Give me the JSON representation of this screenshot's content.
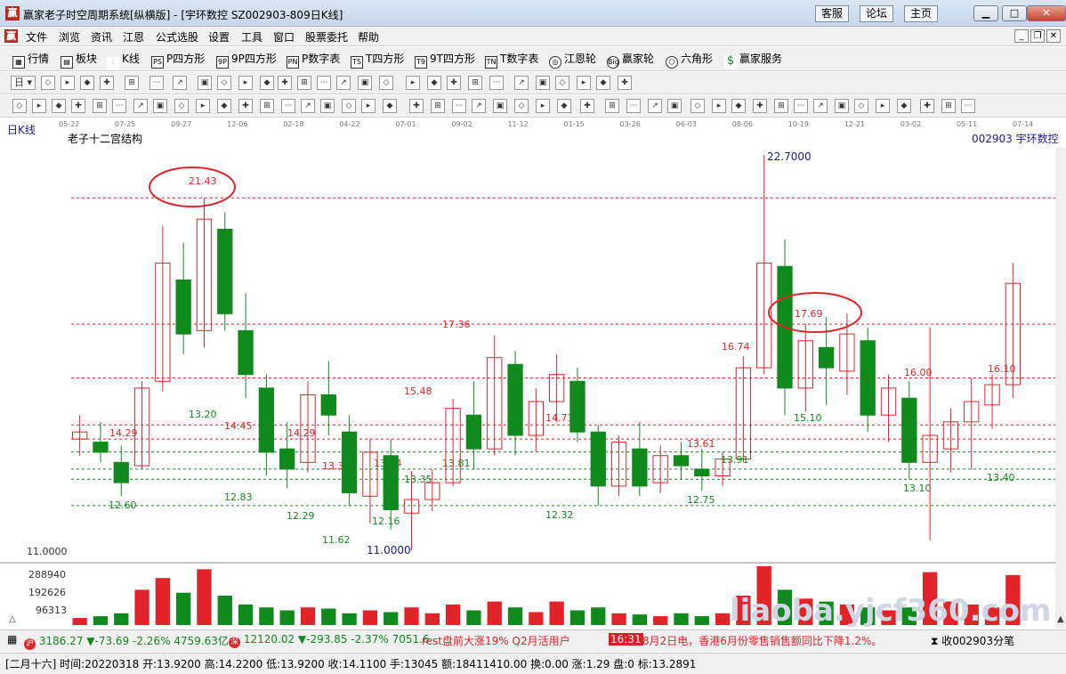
{
  "window": {
    "icon": "赢",
    "title": "赢家老子时空周期系统[纵横版]  - [宇环数控  SZ002903-809日K线]",
    "buttons": [
      "客服",
      "论坛",
      "主页"
    ]
  },
  "menu": {
    "icon": "赢",
    "items": [
      "文件",
      "浏览",
      "资讯",
      "江恩",
      "公式选股",
      "设置",
      "工具",
      "窗口",
      "股票委托",
      "帮助"
    ]
  },
  "toolbar1": [
    {
      "icon": "table-icon",
      "label": "行情"
    },
    {
      "icon": "blocks-icon",
      "label": "板块"
    },
    {
      "icon": "kline-icon",
      "label": "K线"
    },
    {
      "icon": "PS",
      "label": "P四方形"
    },
    {
      "icon": "9P",
      "label": "9P四方形"
    },
    {
      "icon": "PN",
      "label": "P数字表"
    },
    {
      "icon": "TS",
      "label": "T四方形"
    },
    {
      "icon": "T9",
      "label": "9T四方形"
    },
    {
      "icon": "TN",
      "label": "T数字表"
    },
    {
      "icon": "gann-wheel-icon",
      "label": "江恩轮"
    },
    {
      "icon": "Big",
      "label": "赢家轮"
    },
    {
      "icon": "hexagon-icon",
      "label": "六角形"
    },
    {
      "icon": "dollar-icon",
      "label": "赢家服务"
    }
  ],
  "toolbar2": {
    "period": "日"
  },
  "chart": {
    "period_label": "日K线",
    "indicator_name": "老子十二宫结构",
    "stock_label": "002903 宇环数控",
    "date_axis": [
      "05-22",
      "07-25",
      "09-27",
      "12-06",
      "02-18",
      "04-22",
      "07-01",
      "09-02",
      "11-12",
      "01-15",
      "03-26",
      "06-03",
      "08-06",
      "10-19",
      "12-21",
      "03-02",
      "05-11",
      "07-14"
    ],
    "price_min": "11.0000",
    "price_max": "22.7000",
    "levels": [
      "21.43",
      "17.69",
      "14.29",
      "13.35",
      "15.48",
      "17.36",
      "14.71",
      "16.74",
      "16.00",
      "16.10",
      "12.60",
      "13.20",
      "14.45",
      "12.83",
      "14.29",
      "12.29",
      "11.62",
      "12.16",
      "13.44",
      "13.35",
      "13.81",
      "12.32",
      "13.61",
      "12.75",
      "13.91",
      "15.10",
      "13.10",
      "13.40"
    ],
    "volume_axis": [
      "288940",
      "192626",
      "96313"
    ],
    "ohlc": [
      [
        0,
        14.29,
        15.0,
        13.8,
        14.5
      ],
      [
        1,
        14.2,
        14.8,
        13.6,
        13.9
      ],
      [
        2,
        13.6,
        14.1,
        12.6,
        13.0
      ],
      [
        3,
        13.5,
        16.0,
        13.4,
        15.8
      ],
      [
        4,
        16.0,
        20.6,
        15.7,
        19.5
      ],
      [
        5,
        19.0,
        20.1,
        16.8,
        17.4
      ],
      [
        6,
        17.5,
        21.43,
        17.0,
        20.8
      ],
      [
        7,
        20.5,
        21.0,
        17.5,
        18.0
      ],
      [
        8,
        17.5,
        18.6,
        15.5,
        16.2
      ],
      [
        9,
        15.8,
        16.2,
        13.2,
        13.9
      ],
      [
        10,
        14.0,
        14.8,
        12.83,
        13.4
      ],
      [
        11,
        13.6,
        16.0,
        13.3,
        15.6
      ],
      [
        12,
        15.6,
        16.6,
        14.4,
        15.0
      ],
      [
        13,
        14.5,
        15.0,
        12.3,
        12.7
      ],
      [
        14,
        12.6,
        14.3,
        11.8,
        13.9
      ],
      [
        15,
        13.8,
        14.29,
        11.62,
        12.2
      ],
      [
        16,
        12.1,
        13.35,
        11.0,
        12.5
      ],
      [
        17,
        12.5,
        13.4,
        12.16,
        13.0
      ],
      [
        18,
        13.0,
        15.48,
        12.9,
        15.2
      ],
      [
        19,
        15.0,
        16.0,
        13.4,
        14.0
      ],
      [
        20,
        14.0,
        17.36,
        13.8,
        16.7
      ],
      [
        21,
        16.5,
        16.9,
        13.81,
        14.4
      ],
      [
        22,
        14.4,
        15.8,
        13.9,
        15.4
      ],
      [
        23,
        15.4,
        16.8,
        14.8,
        16.2
      ],
      [
        24,
        16.0,
        16.4,
        14.2,
        14.5
      ],
      [
        25,
        14.5,
        14.71,
        12.32,
        12.9
      ],
      [
        26,
        12.9,
        14.4,
        12.6,
        14.2
      ],
      [
        27,
        14.0,
        14.8,
        12.6,
        12.9
      ],
      [
        28,
        13.0,
        14.1,
        12.7,
        13.8
      ],
      [
        29,
        13.8,
        14.2,
        13.1,
        13.5
      ],
      [
        30,
        13.4,
        14.0,
        12.75,
        13.2
      ],
      [
        31,
        13.2,
        13.9,
        12.9,
        13.7
      ],
      [
        32,
        13.7,
        16.74,
        13.6,
        16.4
      ],
      [
        33,
        16.4,
        22.7,
        16.2,
        19.5
      ],
      [
        34,
        19.4,
        20.2,
        15.0,
        15.8
      ],
      [
        35,
        15.8,
        17.69,
        15.1,
        17.2
      ],
      [
        36,
        17.0,
        17.9,
        15.3,
        16.4
      ],
      [
        37,
        16.3,
        18.0,
        15.6,
        17.4
      ],
      [
        38,
        17.2,
        17.6,
        14.5,
        15.0
      ],
      [
        39,
        15.0,
        16.2,
        14.2,
        15.8
      ],
      [
        40,
        15.5,
        16.0,
        13.1,
        13.6
      ],
      [
        41,
        13.6,
        17.6,
        11.3,
        14.4
      ],
      [
        42,
        14.0,
        15.2,
        13.3,
        14.8
      ],
      [
        43,
        14.8,
        16.1,
        13.4,
        15.4
      ],
      [
        44,
        15.3,
        16.2,
        14.6,
        15.9
      ],
      [
        45,
        15.9,
        19.5,
        15.5,
        18.9
      ]
    ],
    "volumes": [
      0.12,
      0.15,
      0.2,
      0.6,
      0.8,
      0.55,
      0.95,
      0.5,
      0.35,
      0.3,
      0.25,
      0.3,
      0.28,
      0.2,
      0.25,
      0.22,
      0.3,
      0.2,
      0.35,
      0.25,
      0.4,
      0.3,
      0.22,
      0.4,
      0.25,
      0.3,
      0.2,
      0.18,
      0.15,
      0.2,
      0.15,
      0.2,
      0.5,
      1.0,
      0.6,
      0.45,
      0.4,
      0.35,
      0.3,
      0.25,
      0.3,
      0.9,
      0.4,
      0.35,
      0.3,
      0.85
    ]
  },
  "status": {
    "index1": {
      "icon": "沪",
      "value": "3186.27",
      "change": "▼-73.69",
      "pct": "-2.26%",
      "amount": "4759.63亿"
    },
    "index2": {
      "icon": "深",
      "value": "12120.02",
      "change": "▼-293.85",
      "pct": "-2.37%",
      "amount": "7051.6"
    },
    "ticker_news": "rest盘前大涨19% Q2月活用户",
    "news_time": "16:31",
    "news": "8月2日电，香港6月份零售销售额同比下降1.2%。",
    "right_text": "收002903分笔",
    "bottom": "[二月十六] 时间:20220318 开:13.9200 高:14.2200 低:13.9200 收:14.1100 手:13045 额:18411410.00 换:0.00 涨:1.29 盘:0 标:13.2891",
    "watermark": "liaoba.yjcf360.com"
  }
}
